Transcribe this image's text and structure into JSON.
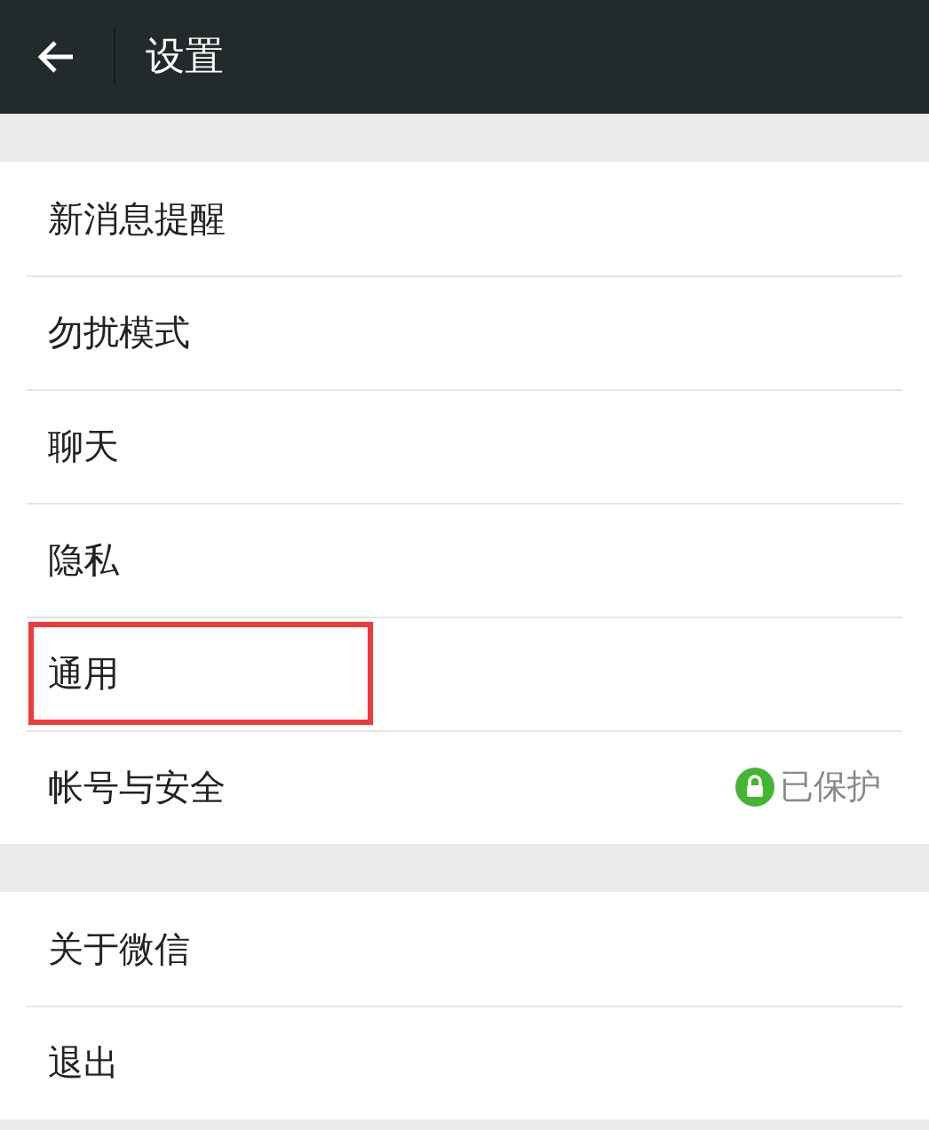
{
  "header": {
    "title": "设置"
  },
  "groups": [
    {
      "items": [
        {
          "label": "新消息提醒",
          "highlighted": false
        },
        {
          "label": "勿扰模式",
          "highlighted": false
        },
        {
          "label": "聊天",
          "highlighted": false
        },
        {
          "label": "隐私",
          "highlighted": false
        },
        {
          "label": "通用",
          "highlighted": true
        },
        {
          "label": "帐号与安全",
          "highlighted": false,
          "status": "已保护"
        }
      ]
    },
    {
      "items": [
        {
          "label": "关于微信",
          "highlighted": false
        },
        {
          "label": "退出",
          "highlighted": false
        }
      ]
    }
  ]
}
